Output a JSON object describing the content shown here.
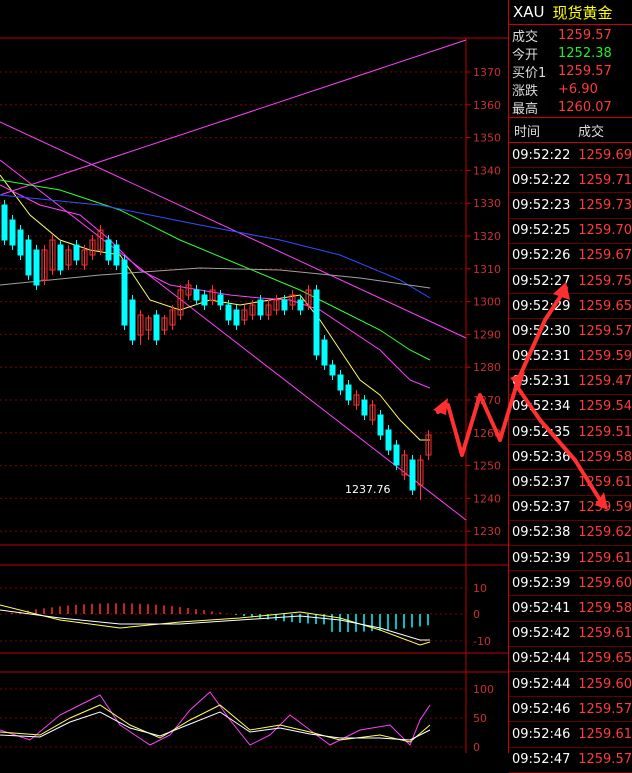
{
  "header": {
    "symbol": "XAU",
    "name": "现货黄金"
  },
  "quote": [
    {
      "label": "成交",
      "value": "1259.57",
      "color": "#ff3b3b"
    },
    {
      "label": "今开",
      "value": "1252.38",
      "color": "#22ee22"
    },
    {
      "label": "买价1",
      "value": "1259.57",
      "color": "#ff3b3b"
    },
    {
      "label": "涨跌",
      "value": "+6.90",
      "color": "#ff3b3b"
    },
    {
      "label": "最高",
      "value": "1260.07",
      "color": "#ff3b3b"
    }
  ],
  "ticks_header": {
    "time": "时间",
    "price": "成交"
  },
  "ticks": [
    {
      "time": "09:52:22",
      "price": "1259.69"
    },
    {
      "time": "09:52:22",
      "price": "1259.71"
    },
    {
      "time": "09:52:23",
      "price": "1259.73"
    },
    {
      "time": "09:52:25",
      "price": "1259.70"
    },
    {
      "time": "09:52:26",
      "price": "1259.67"
    },
    {
      "time": "09:52:27",
      "price": "1259.75"
    },
    {
      "time": "09:52:29",
      "price": "1259.65"
    },
    {
      "time": "09:52:30",
      "price": "1259.57"
    },
    {
      "time": "09:52:31",
      "price": "1259.59"
    },
    {
      "time": "09:52:31",
      "price": "1259.47"
    },
    {
      "time": "09:52:34",
      "price": "1259.54"
    },
    {
      "time": "09:52:35",
      "price": "1259.51"
    },
    {
      "time": "09:52:36",
      "price": "1259.58"
    },
    {
      "time": "09:52:37",
      "price": "1259.61"
    },
    {
      "time": "09:52:37",
      "price": "1259.59"
    },
    {
      "time": "09:52:38",
      "price": "1259.62"
    },
    {
      "time": "09:52:39",
      "price": "1259.61"
    },
    {
      "time": "09:52:39",
      "price": "1259.60"
    },
    {
      "time": "09:52:41",
      "price": "1259.58"
    },
    {
      "time": "09:52:42",
      "price": "1259.61"
    },
    {
      "time": "09:52:44",
      "price": "1259.65"
    },
    {
      "time": "09:52:44",
      "price": "1259.60"
    },
    {
      "time": "09:52:46",
      "price": "1259.57"
    },
    {
      "time": "09:52:46",
      "price": "1259.61"
    },
    {
      "time": "09:52:47",
      "price": "1259.57"
    }
  ],
  "price_axis": [
    "1370",
    "1360",
    "1350",
    "1340",
    "1330",
    "1320",
    "1310",
    "1300",
    "1290",
    "1280",
    "1270",
    "1260",
    "1250",
    "1240",
    "1230"
  ],
  "macd_axis": [
    "10",
    "0",
    "-10"
  ],
  "kdj_axis": [
    "100",
    "50",
    "0"
  ],
  "low_label": "1237.76",
  "colors": {
    "up": "#ff3030",
    "down": "#00ffff",
    "grid": "#800000",
    "axis": "#c00000",
    "channel": "#ff40ff"
  }
}
